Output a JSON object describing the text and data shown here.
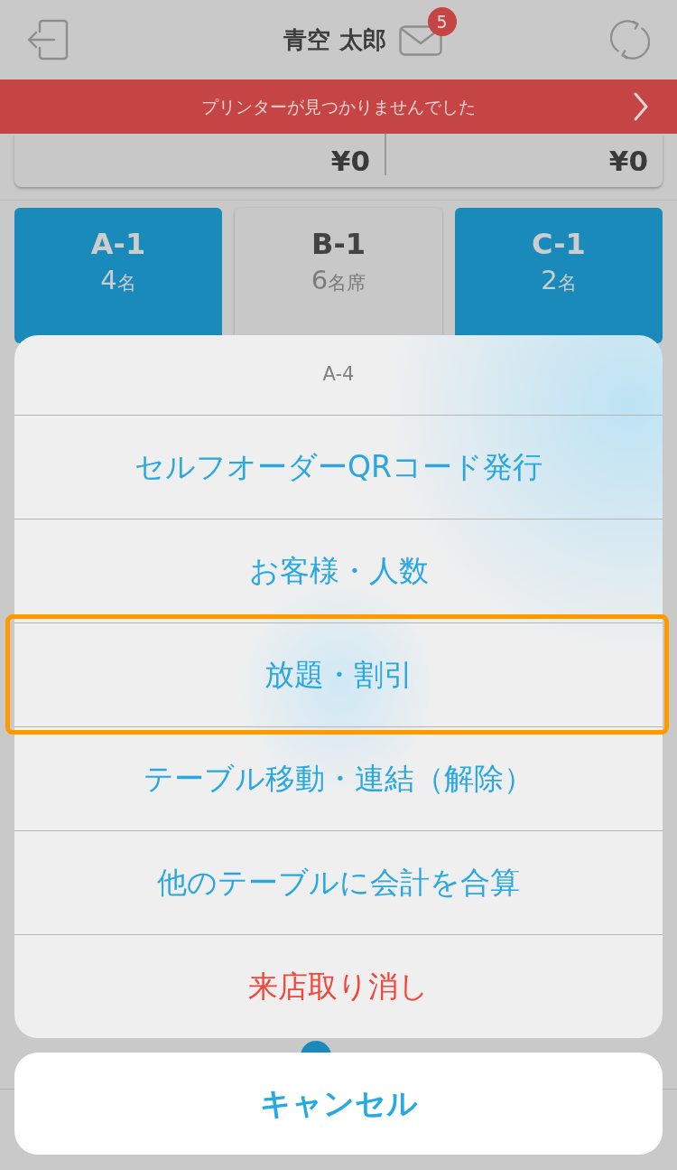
{
  "header": {
    "title": "青空 太郎",
    "mail_badge": "5"
  },
  "alert_banner": {
    "message": "プリンターが見つかりませんでした"
  },
  "summary": {
    "values": [
      "¥0",
      "¥0"
    ]
  },
  "tables": [
    {
      "name": "A-1",
      "count": "4",
      "unit": "名",
      "occupied": true
    },
    {
      "name": "B-1",
      "count": "6",
      "unit": "名席",
      "occupied": false
    },
    {
      "name": "C-1",
      "count": "2",
      "unit": "名",
      "occupied": true
    }
  ],
  "action_sheet": {
    "title": "A-4",
    "items": [
      {
        "label": "セルフオーダーQRコード発行",
        "kind": "default",
        "highlighted": false
      },
      {
        "label": "お客様・人数",
        "kind": "default",
        "highlighted": false
      },
      {
        "label": "放題・割引",
        "kind": "default",
        "highlighted": true
      },
      {
        "label": "テーブル移動・連結（解除）",
        "kind": "default",
        "highlighted": false
      },
      {
        "label": "他のテーブルに会計を合算",
        "kind": "default",
        "highlighted": false
      },
      {
        "label": "来店取り消し",
        "kind": "destructive",
        "highlighted": false
      }
    ],
    "cancel": "キャンセル"
  }
}
